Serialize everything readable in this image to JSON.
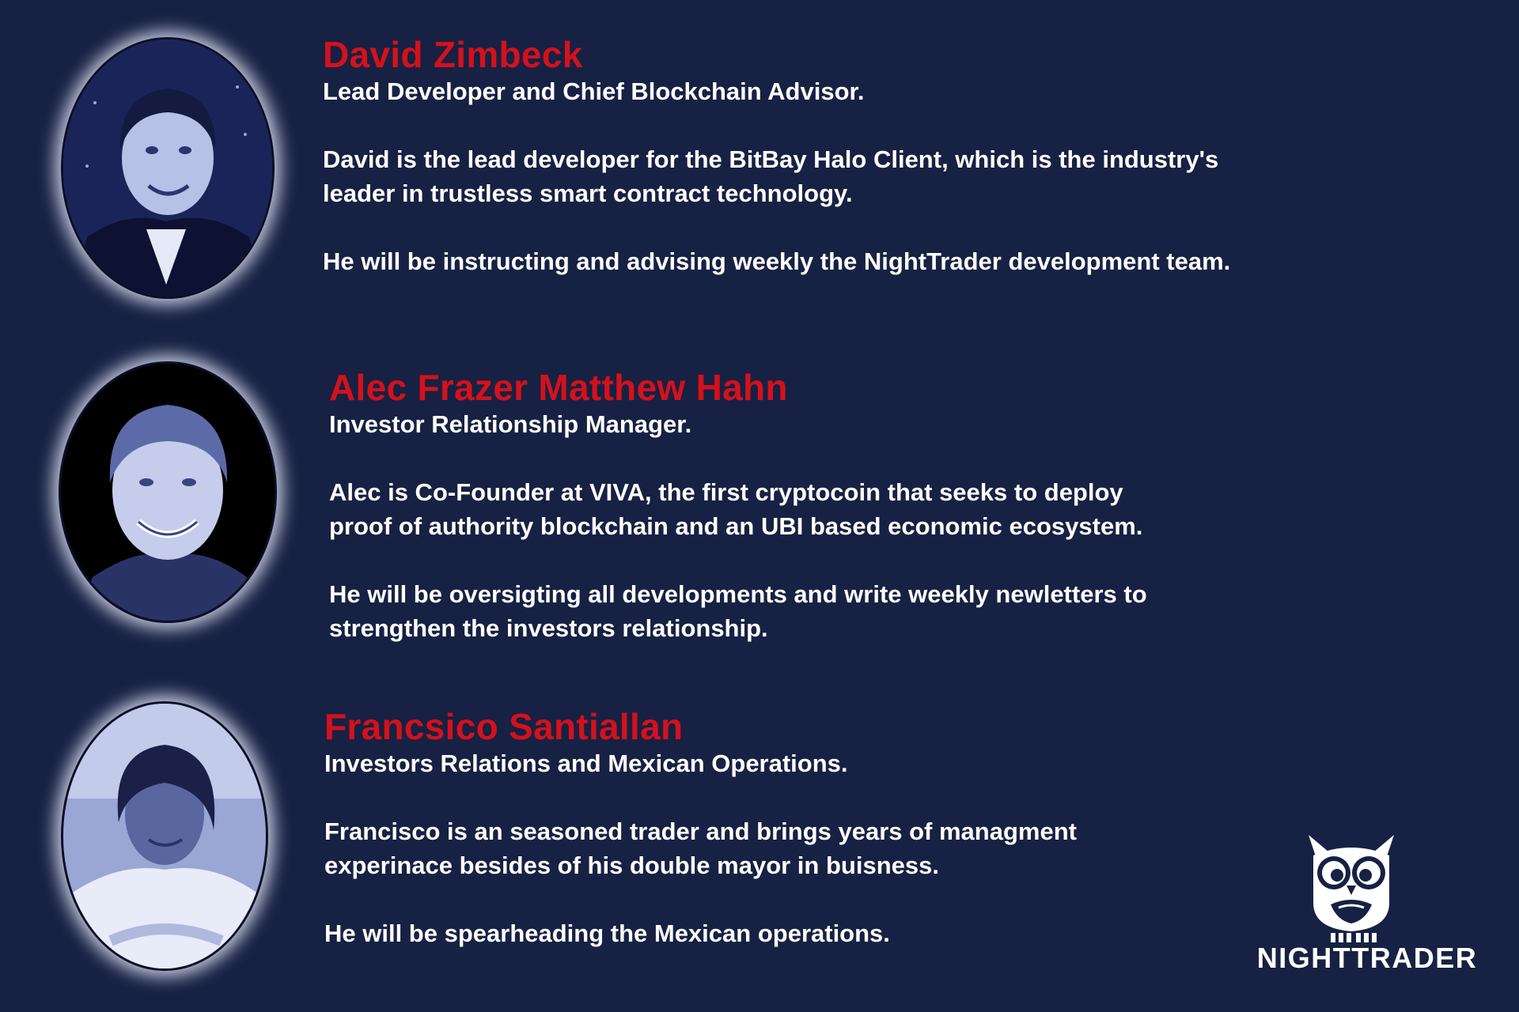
{
  "team": [
    {
      "name": "David Zimbeck",
      "role": "Lead Developer and Chief Blockchain Advisor.",
      "paragraphs": [
        "David is the lead developer for the BitBay Halo Client, which is the industry's\nleader in trustless smart contract technology.",
        "He will be instructing and advising weekly the NightTrader development team."
      ]
    },
    {
      "name": "Alec Frazer Matthew Hahn",
      "role": "Investor Relationship Manager.",
      "paragraphs": [
        "Alec is Co-Founder at VIVA, the first cryptocoin that seeks to deploy\nproof of authority blockchain and an UBI based economic ecosystem.",
        "He will be oversigting all developments and write weekly newletters to\nstrengthen the investors relationship."
      ]
    },
    {
      "name": "Francsico Santiallan",
      "role": "Investors Relations and Mexican Operations.",
      "paragraphs": [
        "Francisco is an seasoned trader and brings years of managment\nexperinace besides of his double mayor in buisness.",
        "He will be spearheading the Mexican operations."
      ]
    }
  ],
  "logo": {
    "text": "NIGHTTRADER",
    "icon": "owl-icon"
  },
  "colors": {
    "background": "#172143",
    "name_red": "#d4111b",
    "text_white": "#ffffff"
  }
}
